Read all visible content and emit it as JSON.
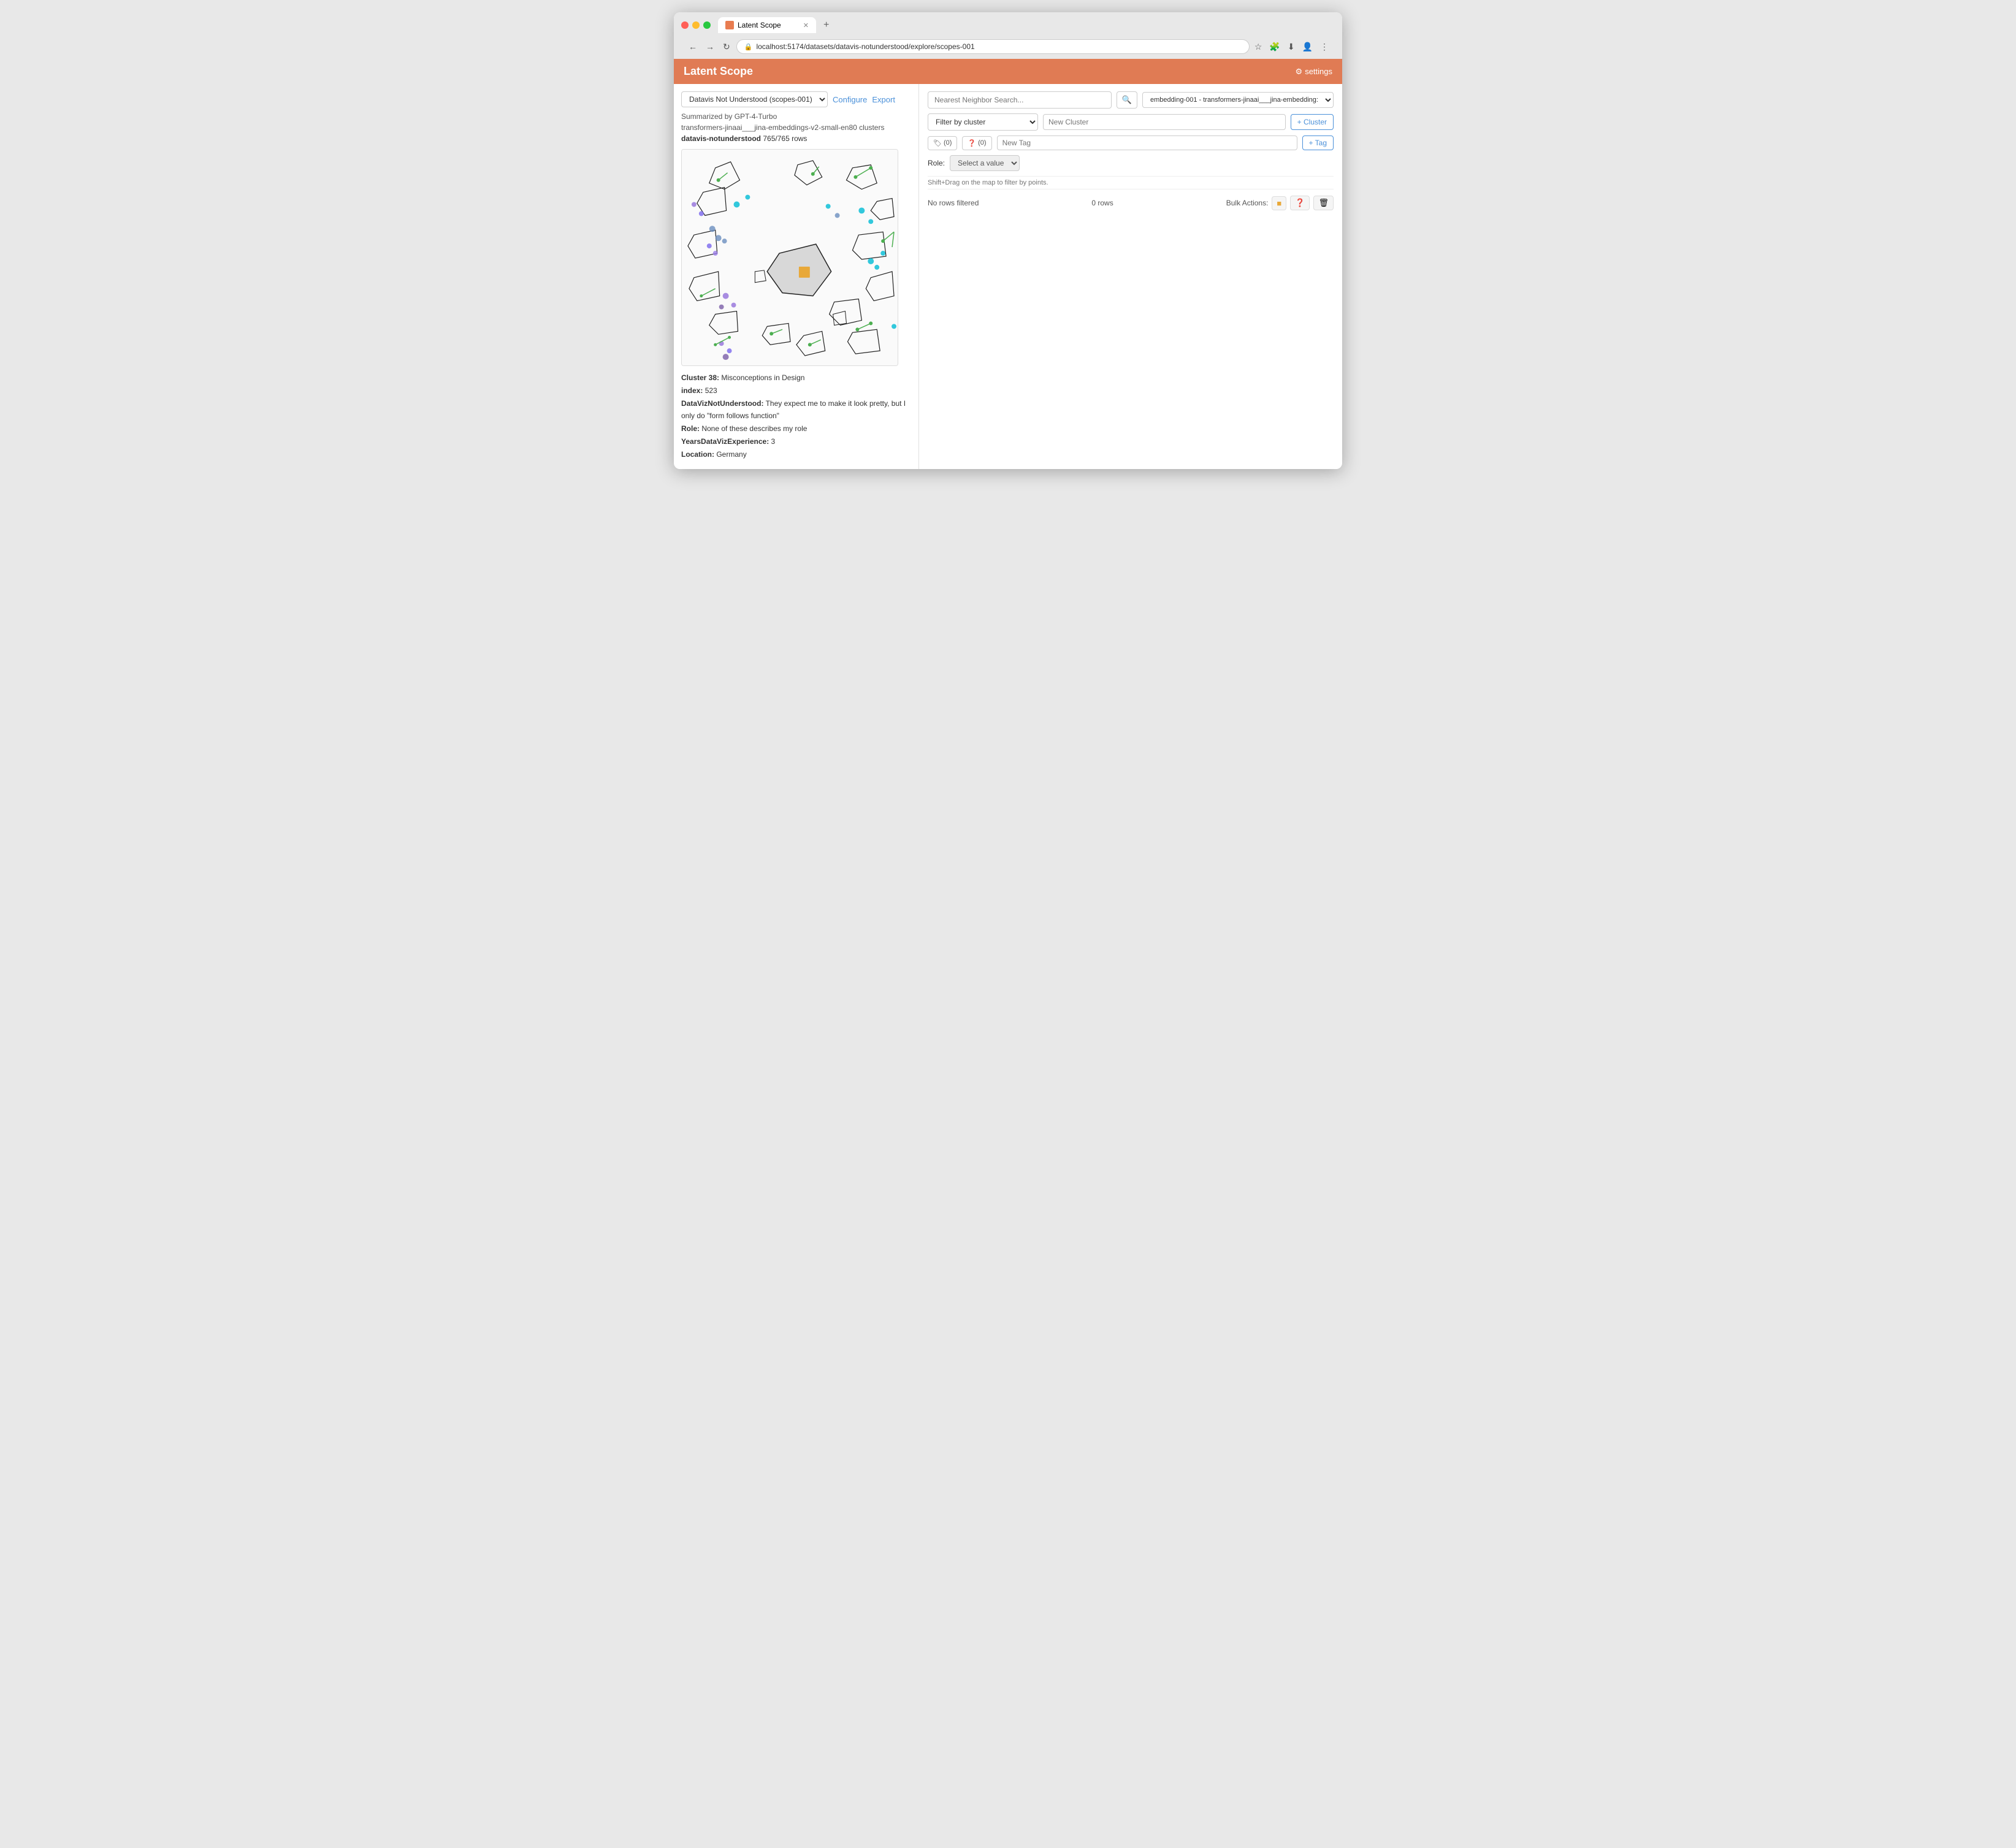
{
  "browser": {
    "tab_title": "Latent Scope",
    "url": "localhost:5174/datasets/datavis-notunderstood/explore/scopes-001",
    "new_tab_label": "+",
    "nav_back": "←",
    "nav_forward": "→",
    "nav_refresh": "↻"
  },
  "app": {
    "title": "Latent Scope",
    "settings_label": "settings",
    "settings_icon": "⚙"
  },
  "left_panel": {
    "dataset_dropdown": "Datavis Not Understood (scopes-001)",
    "configure_label": "Configure",
    "export_label": "Export",
    "summarized_by": "Summarized by GPT-4-Turbo",
    "model_info": "transformers-jinaai___jina-embeddings-v2-small-en80 clusters",
    "dataset_name": "datavis-notunderstood",
    "rows_info": "765/765 rows"
  },
  "info_panel": {
    "cluster_label": "Cluster 38:",
    "cluster_value": "  Misconceptions in Design",
    "index_label": "index:",
    "index_value": "  523",
    "dataviz_label": "DataVizNotUnderstood:",
    "dataviz_value": "  They expect me to make it look pretty, but I only do \"form follows function\"",
    "role_label": "Role:",
    "role_value": "  None of these describes my role",
    "years_label": "YearsDataVizExperience:",
    "years_value": "  3",
    "location_label": "Location:",
    "location_value": "  Germany"
  },
  "right_panel": {
    "search_placeholder": "Nearest Neighbor Search...",
    "search_icon": "🔍",
    "embedding_select": "embedding-001 - transformers-jinaai___jina-embedding:",
    "filter_by_cluster": "Filter by cluster",
    "new_cluster_placeholder": "New Cluster",
    "new_cluster_btn": "+ Cluster",
    "tag_btn1_icon": "🏷",
    "tag_btn1_count": "(0)",
    "tag_btn2_icon": "❓",
    "tag_btn2_count": "(0)",
    "new_tag_placeholder": "New Tag",
    "add_tag_btn": "+ Tag",
    "role_label": "Role:",
    "role_select_placeholder": "Select a value",
    "hint_text": "Shift+Drag on the map to filter by points.",
    "no_rows_filtered": "No rows filtered",
    "rows_count": "0 rows",
    "bulk_actions_label": "Bulk Actions:",
    "bulk_btn1": "🟠",
    "bulk_btn2": "❓",
    "bulk_btn3": "🗑"
  }
}
